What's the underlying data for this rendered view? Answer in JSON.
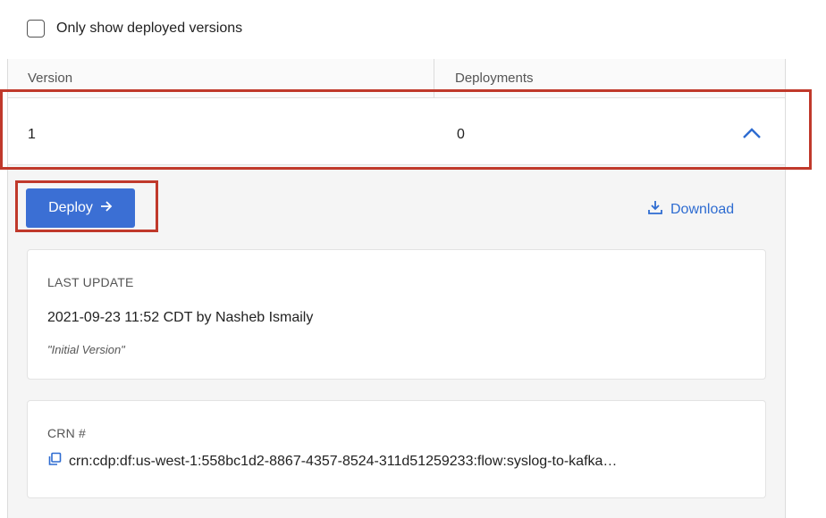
{
  "filter": {
    "label": "Only show deployed versions",
    "checked": false
  },
  "table": {
    "columns": [
      "Version",
      "Deployments"
    ],
    "rows": [
      {
        "version": "1",
        "deployments": "0",
        "expanded": true
      }
    ]
  },
  "actions": {
    "deploy_label": "Deploy",
    "deploy_icon": "arrow-right-icon",
    "download_label": "Download",
    "download_icon": "download-icon"
  },
  "last_update": {
    "label": "LAST UPDATE",
    "text": "2021-09-23 11:52 CDT by Nasheb Ismaily",
    "note": "\"Initial Version\""
  },
  "crn": {
    "label": "CRN #",
    "value": "crn:cdp:df:us-west-1:558bc1d2-8867-4357-8524-311d51259233:flow:syslog-to-kafka…",
    "icon": "copy-icon"
  },
  "colors": {
    "accent": "#3b6fd4",
    "link": "#2e6cd1",
    "highlight": "#c0392b"
  }
}
